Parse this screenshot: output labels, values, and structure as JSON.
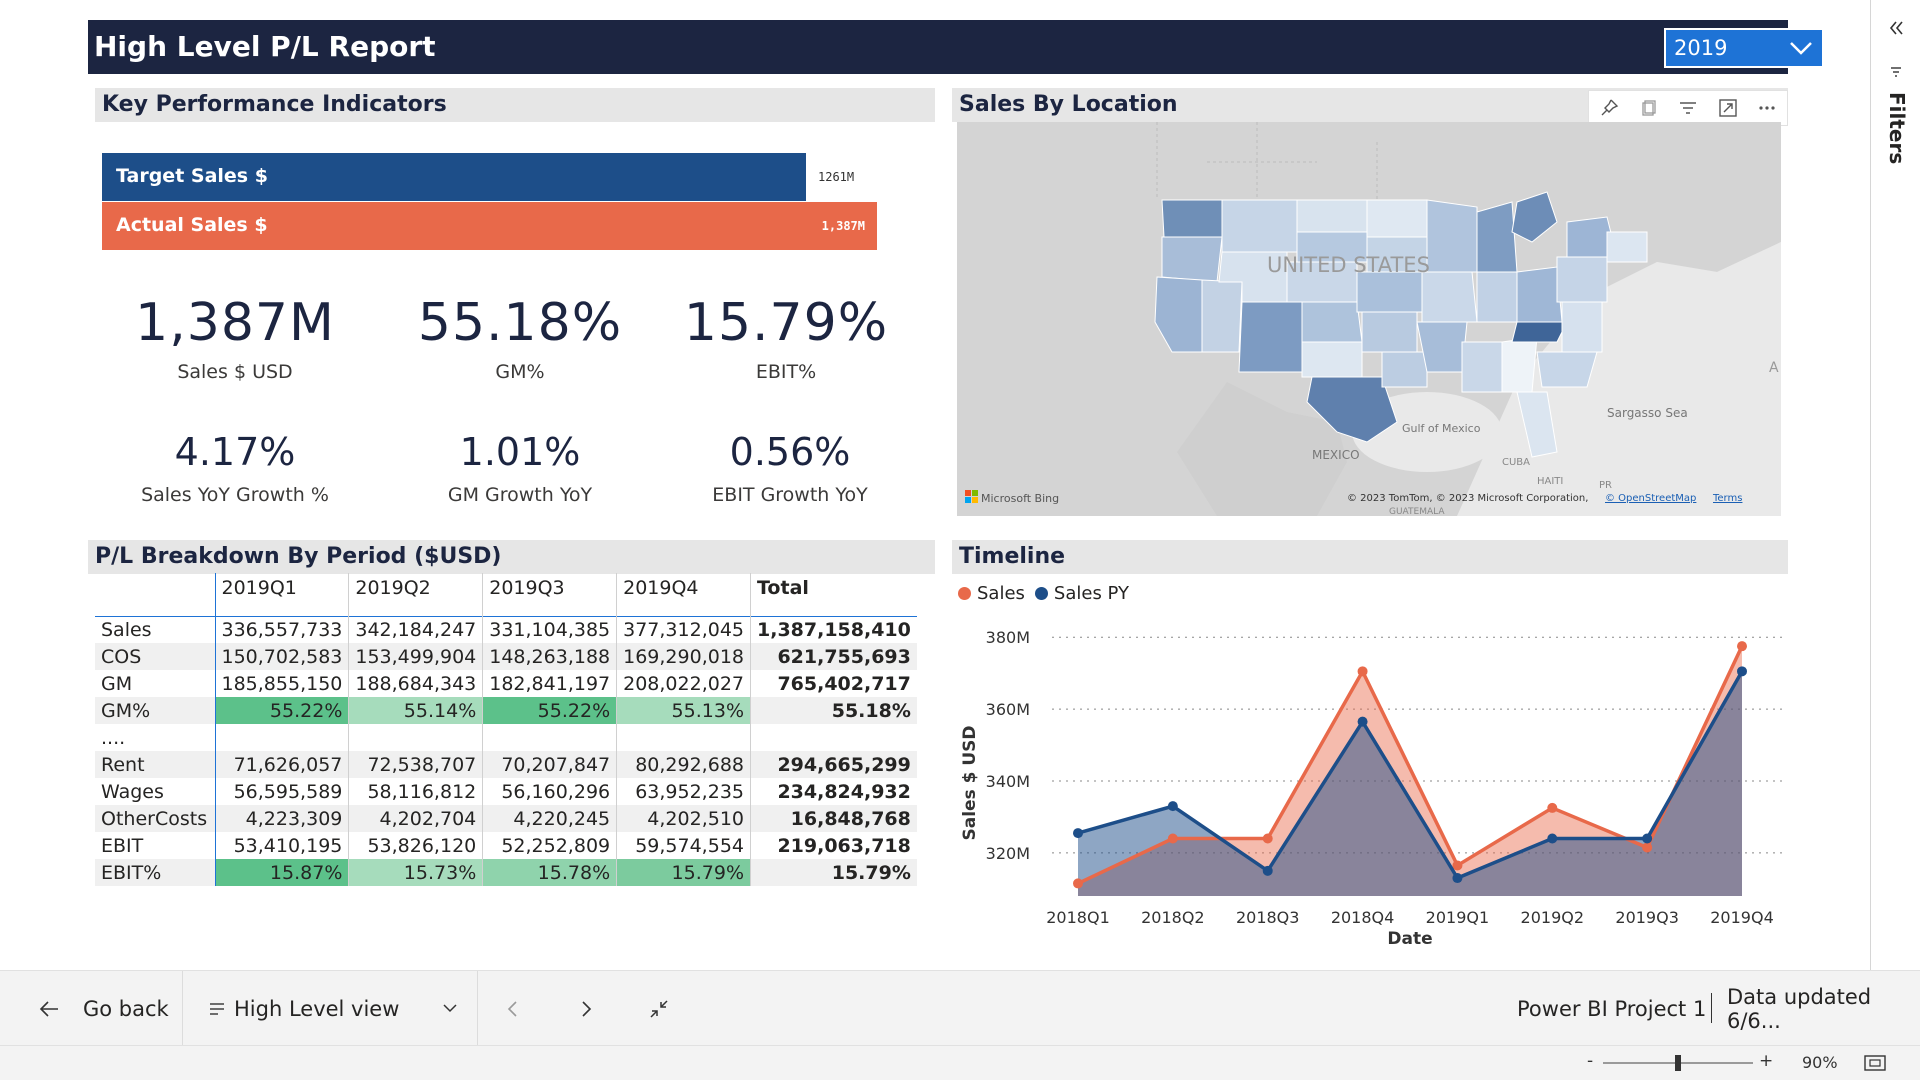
{
  "report": {
    "title": "High Level P/L Report",
    "year_selected": "2019"
  },
  "colors": {
    "navy": "#1c2541",
    "orange": "#e8694a",
    "blue_target": "#1d4e89",
    "green_dark": "#5cc18a",
    "green_light": "#a6dcbc"
  },
  "kpi_section": {
    "header": "Key Performance Indicators",
    "target_label": "Target Sales $",
    "target_value": "1261M",
    "actual_label": "Actual Sales $",
    "actual_value": "1,387M",
    "target_fraction": 0.909,
    "cards": [
      {
        "value": "1,387M",
        "label": "Sales $ USD"
      },
      {
        "value": "55.18%",
        "label": "GM%"
      },
      {
        "value": "15.79%",
        "label": "EBIT%"
      },
      {
        "value": "4.17%",
        "label": "Sales YoY Growth %"
      },
      {
        "value": "1.01%",
        "label": "GM Growth YoY"
      },
      {
        "value": "0.56%",
        "label": "EBIT Growth YoY"
      }
    ]
  },
  "map_section": {
    "header": "Sales By Location",
    "labels": {
      "country": "UNITED STATES",
      "mexico": "MEXICO",
      "gulf": "Gulf of Mexico",
      "sargasso": "Sargasso Sea",
      "cuba": "CUBA",
      "haiti": "HAITI",
      "pr": "PR",
      "guatemala": "GUATEMALA",
      "edge_letter": "A"
    },
    "bing": "Microsoft Bing",
    "attribution": "© 2023 TomTom, © 2023 Microsoft Corporation,",
    "osm_link": "© OpenStreetMap",
    "terms_link": "Terms",
    "toolbar_icons": [
      "pin-icon",
      "copy-icon",
      "filter-icon",
      "focus-mode-icon",
      "more-options-icon"
    ]
  },
  "table_section": {
    "header": "P/L Breakdown By Period ($USD)",
    "columns": [
      "",
      "2019Q1",
      "2019Q2",
      "2019Q3",
      "2019Q4",
      "Total"
    ],
    "rows": [
      {
        "label": "Sales",
        "cells": [
          "336,557,733",
          "342,184,247",
          "331,104,385",
          "377,312,045"
        ],
        "total": "1,387,158,410"
      },
      {
        "label": "COS",
        "cells": [
          "150,702,583",
          "153,499,904",
          "148,263,188",
          "169,290,018"
        ],
        "total": "621,755,693"
      },
      {
        "label": "GM",
        "cells": [
          "185,855,150",
          "188,684,343",
          "182,841,197",
          "208,022,027"
        ],
        "total": "765,402,717"
      },
      {
        "label": "GM%",
        "cells": [
          "55.22%",
          "55.14%",
          "55.22%",
          "55.13%"
        ],
        "total": "55.18%",
        "heat": [
          "#5cc18a",
          "#a6dcbc",
          "#5cc18a",
          "#a6dcbc"
        ]
      },
      {
        "label": "....",
        "cells": [
          "",
          "",
          "",
          ""
        ],
        "total": ""
      },
      {
        "label": "Rent",
        "cells": [
          "71,626,057",
          "72,538,707",
          "70,207,847",
          "80,292,688"
        ],
        "total": "294,665,299"
      },
      {
        "label": "Wages",
        "cells": [
          "56,595,589",
          "58,116,812",
          "56,160,296",
          "63,952,235"
        ],
        "total": "234,824,932"
      },
      {
        "label": "OtherCosts",
        "cells": [
          "4,223,309",
          "4,202,704",
          "4,220,245",
          "4,202,510"
        ],
        "total": "16,848,768"
      },
      {
        "label": "EBIT",
        "cells": [
          "53,410,195",
          "53,826,120",
          "52,252,809",
          "59,574,554"
        ],
        "total": "219,063,718"
      },
      {
        "label": "EBIT%",
        "cells": [
          "15.87%",
          "15.73%",
          "15.78%",
          "15.79%"
        ],
        "total": "15.79%",
        "heat": [
          "#5cc18a",
          "#a6dcbc",
          "#8fd3ac",
          "#7ccb9e"
        ]
      }
    ]
  },
  "timeline_section": {
    "header": "Timeline"
  },
  "chart_data": {
    "type": "area",
    "x": [
      "2018Q1",
      "2018Q2",
      "2018Q3",
      "2018Q4",
      "2019Q1",
      "2019Q2",
      "2019Q3",
      "2019Q4"
    ],
    "series": [
      {
        "name": "Sales",
        "color": "#e8694a",
        "values": [
          311.5,
          324,
          324,
          370.5,
          316.5,
          332.5,
          321.5,
          377.5
        ]
      },
      {
        "name": "Sales PY",
        "color": "#1d4e89",
        "values": [
          325.5,
          333,
          315,
          356.5,
          313,
          324,
          324,
          370.5
        ]
      }
    ],
    "xlabel": "Date",
    "ylabel": "Sales $ USD",
    "yticks": [
      "320M",
      "340M",
      "360M",
      "380M"
    ],
    "ylim": [
      308,
      382
    ],
    "grid": true,
    "legend_position": "top-left"
  },
  "bottom_nav": {
    "back_label": "Go back",
    "page_label": "High Level view",
    "project_label": "Power BI Project 1",
    "updated_label": "Data updated 6/6..."
  },
  "status": {
    "zoom_minus": "-",
    "zoom_plus": "+",
    "zoom_value": "90%",
    "zoom_level": 0.5
  },
  "filters_label": "Filters"
}
